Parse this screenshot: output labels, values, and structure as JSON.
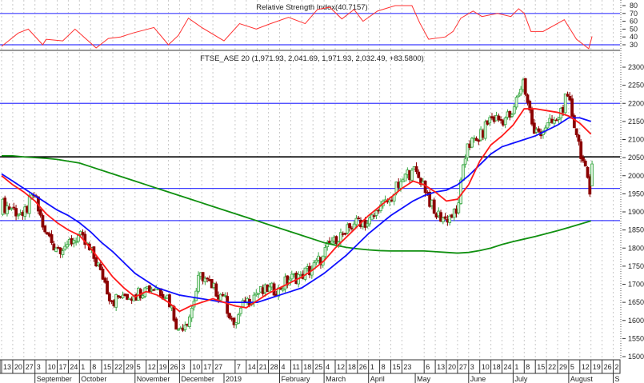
{
  "rsi_panel": {
    "title": "Relative Strength Index(40.7157)",
    "y_ticks": [
      "80",
      "70",
      "60",
      "50",
      "40",
      "30"
    ]
  },
  "price_panel": {
    "title": "FTSE_ASE 20 (1,971.93, 2,041.69, 1,971.93, 2,032.49, +83.5800)",
    "y_ticks": [
      "2300",
      "2250",
      "2200",
      "2150",
      "2100",
      "2050",
      "2000",
      "1950",
      "1900",
      "1850",
      "1800",
      "1750",
      "1700",
      "1650",
      "1600",
      "1550",
      "1500"
    ]
  },
  "x_axis": {
    "day_labels": [
      {
        "w": 0,
        "t": "13"
      },
      {
        "w": 1,
        "t": "20"
      },
      {
        "w": 2,
        "t": "27"
      },
      {
        "w": 3,
        "t": "3"
      },
      {
        "w": 4,
        "t": "10"
      },
      {
        "w": 5,
        "t": "17"
      },
      {
        "w": 6,
        "t": "24"
      },
      {
        "w": 7,
        "t": "1"
      },
      {
        "w": 8,
        "t": "8"
      },
      {
        "w": 9,
        "t": "15"
      },
      {
        "w": 10,
        "t": "22"
      },
      {
        "w": 11,
        "t": "29"
      },
      {
        "w": 12,
        "t": "5"
      },
      {
        "w": 13,
        "t": "12"
      },
      {
        "w": 14,
        "t": "19"
      },
      {
        "w": 15,
        "t": "26"
      },
      {
        "w": 16,
        "t": "3"
      },
      {
        "w": 17,
        "t": "10"
      },
      {
        "w": 18,
        "t": "17"
      },
      {
        "w": 19,
        "t": "27"
      },
      {
        "w": 21,
        "t": "7"
      },
      {
        "w": 22,
        "t": "14"
      },
      {
        "w": 23,
        "t": "21"
      },
      {
        "w": 24,
        "t": "28"
      },
      {
        "w": 25,
        "t": "4"
      },
      {
        "w": 26,
        "t": "11"
      },
      {
        "w": 27,
        "t": "18"
      },
      {
        "w": 28,
        "t": "25"
      },
      {
        "w": 29,
        "t": "4"
      },
      {
        "w": 30,
        "t": "12"
      },
      {
        "w": 31,
        "t": "18"
      },
      {
        "w": 32,
        "t": "26"
      },
      {
        "w": 33,
        "t": "1"
      },
      {
        "w": 34,
        "t": "8"
      },
      {
        "w": 35,
        "t": "15"
      },
      {
        "w": 36,
        "t": "23"
      },
      {
        "w": 38,
        "t": "6"
      },
      {
        "w": 39,
        "t": "13"
      },
      {
        "w": 40,
        "t": "20"
      },
      {
        "w": 41,
        "t": "27"
      },
      {
        "w": 42,
        "t": "3"
      },
      {
        "w": 43,
        "t": "10"
      },
      {
        "w": 44,
        "t": "18"
      },
      {
        "w": 45,
        "t": "24"
      },
      {
        "w": 46,
        "t": "1"
      },
      {
        "w": 47,
        "t": "8"
      },
      {
        "w": 48,
        "t": "15"
      },
      {
        "w": 49,
        "t": "22"
      },
      {
        "w": 50,
        "t": "29"
      },
      {
        "w": 51,
        "t": "5"
      },
      {
        "w": 52,
        "t": "12"
      },
      {
        "w": 53,
        "t": "19"
      },
      {
        "w": 54,
        "t": "26"
      },
      {
        "w": 55,
        "t": "2"
      }
    ],
    "month_labels": [
      {
        "w": 3,
        "t": "September"
      },
      {
        "w": 7,
        "t": "October"
      },
      {
        "w": 12,
        "t": "November"
      },
      {
        "w": 16,
        "t": "December"
      },
      {
        "w": 20,
        "t": "2019"
      },
      {
        "w": 25,
        "t": "February"
      },
      {
        "w": 29,
        "t": "March"
      },
      {
        "w": 33,
        "t": "April"
      },
      {
        "w": 37.2,
        "t": "May"
      },
      {
        "w": 42,
        "t": "June"
      },
      {
        "w": 46,
        "t": "July"
      },
      {
        "w": 51,
        "t": "August"
      },
      {
        "w": 55,
        "t": "S"
      }
    ]
  },
  "chart_data": {
    "type": "candlestick",
    "x_unit": "weeks since 13 Aug 2018",
    "price_range": [
      1500,
      2300
    ],
    "rsi_range": [
      30,
      80
    ],
    "weekly_close": [
      1910,
      1890,
      1945,
      1845,
      1800,
      1810,
      1835,
      1795,
      1740,
      1652,
      1670,
      1668,
      1690,
      1690,
      1670,
      1575,
      1610,
      1732,
      1690,
      1668,
      1588,
      1650,
      1675,
      1680,
      1690,
      1712,
      1727,
      1741,
      1778,
      1830,
      1838,
      1882,
      1867,
      1904,
      1933,
      1984,
      2015,
      1984,
      1896,
      1882,
      1896,
      2088,
      2095,
      2161,
      2154,
      2169,
      2265,
      2117,
      2132,
      2154,
      2220,
      2095,
      1949
    ],
    "last_candle": {
      "open": 1971.93,
      "high": 2041.69,
      "low": 1971.93,
      "close": 2032.49,
      "change": 83.58
    },
    "ma_short_red": [
      2000,
      1975,
      1955,
      1930,
      1895,
      1870,
      1850,
      1835,
      1800,
      1760,
      1720,
      1690,
      1665,
      1680,
      1670,
      1650,
      1625,
      1640,
      1650,
      1660,
      1650,
      1640,
      1635,
      1655,
      1675,
      1690,
      1705,
      1720,
      1740,
      1765,
      1800,
      1830,
      1860,
      1890,
      1915,
      1940,
      1965,
      1985,
      1975,
      1955,
      1930,
      1935,
      1975,
      2040,
      2085,
      2110,
      2140,
      2185,
      2185,
      2180,
      2175,
      2165,
      2145,
      2115
    ],
    "ma_mid_blue": [
      2005,
      1985,
      1965,
      1945,
      1925,
      1905,
      1890,
      1870,
      1845,
      1815,
      1790,
      1760,
      1730,
      1710,
      1690,
      1680,
      1670,
      1665,
      1660,
      1655,
      1650,
      1650,
      1650,
      1650,
      1660,
      1670,
      1680,
      1690,
      1710,
      1730,
      1755,
      1780,
      1810,
      1840,
      1865,
      1890,
      1910,
      1930,
      1945,
      1955,
      1960,
      1975,
      2000,
      2030,
      2060,
      2080,
      2090,
      2100,
      2110,
      2125,
      2140,
      2160,
      2160,
      2150
    ],
    "ma_long_green": [
      2055,
      2055,
      2052,
      2050,
      2048,
      2045,
      2040,
      2035,
      2025,
      2015,
      2005,
      1995,
      1985,
      1975,
      1965,
      1955,
      1945,
      1935,
      1925,
      1915,
      1905,
      1895,
      1885,
      1875,
      1865,
      1855,
      1845,
      1835,
      1825,
      1815,
      1808,
      1802,
      1798,
      1795,
      1793,
      1792,
      1792,
      1792,
      1792,
      1790,
      1788,
      1786,
      1788,
      1793,
      1800,
      1810,
      1818,
      1825,
      1832,
      1840,
      1848,
      1857,
      1866,
      1875
    ],
    "reference_lines": [
      {
        "value": 2200,
        "color": "#3b3bff"
      },
      {
        "value": 2052,
        "color": "#000000"
      },
      {
        "value": 1965,
        "color": "#3b3bff"
      },
      {
        "value": 1876,
        "color": "#3b3bff"
      }
    ],
    "rsi_levels": [
      70,
      30
    ],
    "rsi": [
      [
        0,
        28
      ],
      [
        1.5,
        45
      ],
      [
        2.4,
        50
      ],
      [
        3.7,
        30
      ],
      [
        4,
        37
      ],
      [
        5.5,
        35
      ],
      [
        6.6,
        50
      ],
      [
        8.5,
        26
      ],
      [
        9.6,
        38
      ],
      [
        10.7,
        40
      ],
      [
        11.8,
        45
      ],
      [
        13.7,
        52
      ],
      [
        15,
        30
      ],
      [
        15.9,
        42
      ],
      [
        16.8,
        64
      ],
      [
        18,
        52
      ],
      [
        20,
        35
      ],
      [
        21.4,
        57
      ],
      [
        22.9,
        50
      ],
      [
        24,
        56
      ],
      [
        25.8,
        65
      ],
      [
        27.3,
        57
      ],
      [
        28.4,
        75
      ],
      [
        29.5,
        78
      ],
      [
        30.6,
        63
      ],
      [
        31.7,
        75
      ],
      [
        32.5,
        60
      ],
      [
        33.8,
        73
      ],
      [
        35.4,
        80
      ],
      [
        36.9,
        80
      ],
      [
        37.6,
        58
      ],
      [
        38.4,
        37
      ],
      [
        39.9,
        40
      ],
      [
        40.6,
        47
      ],
      [
        41.3,
        64
      ],
      [
        42.4,
        73
      ],
      [
        43.2,
        66
      ],
      [
        44.6,
        70
      ],
      [
        45.8,
        66
      ],
      [
        46.5,
        76
      ],
      [
        47,
        70
      ],
      [
        47.6,
        47
      ],
      [
        48.7,
        47
      ],
      [
        50.6,
        62
      ],
      [
        51.7,
        37
      ],
      [
        52.8,
        25
      ],
      [
        53.1,
        40.7
      ]
    ],
    "colors": {
      "up": "#3aa845",
      "up_fill": "#d8f0d8",
      "down": "#8b0000",
      "ma_short": "#ff1a1a",
      "ma_mid": "#1010ff",
      "ma_long": "#109010",
      "rsi": "#ff3030"
    }
  }
}
